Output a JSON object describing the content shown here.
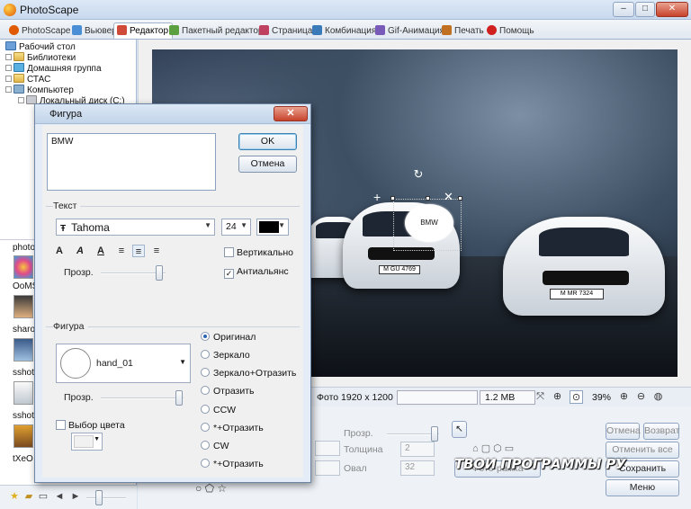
{
  "window": {
    "title": "PhotoScape",
    "min": "–",
    "max": "□",
    "close": "✕"
  },
  "tabs": [
    {
      "label": "PhotoScape",
      "color": "#e05a00"
    },
    {
      "label": "Вьювер",
      "color": "#4a8fd6"
    },
    {
      "label": "Редактор",
      "color": "#d04a3a"
    },
    {
      "label": "Пакетный редактор",
      "color": "#5aa040"
    },
    {
      "label": "Страница",
      "color": "#c04060"
    },
    {
      "label": "Комбинация",
      "color": "#3a7ab8"
    },
    {
      "label": "Gif-Анимация",
      "color": "#7a5ab8"
    },
    {
      "label": "Печать",
      "color": "#c07020"
    },
    {
      "label": "Помощь",
      "color": "#d02020"
    }
  ],
  "tree": [
    "Рабочий стол",
    "Библиотеки",
    "Домашняя группа",
    "СТАС",
    "Компьютер",
    "Локальный диск (C:)"
  ],
  "thumbs": [
    "photo",
    "OoMS",
    "sharo",
    "sshot",
    "sshot",
    "tXeO"
  ],
  "image": {
    "bubble_text": "BMW",
    "plate_left": "M GU 4769",
    "plate_right": "M MR 7324"
  },
  "status": {
    "photo_size": "Фото 1920 x 1200",
    "file_size": "1.2 MB",
    "zoom": "39%"
  },
  "editor": {
    "prozr_label": "Прозр.",
    "thickness_label": "Толщина",
    "thickness_value": "2",
    "oval_label": "Овал",
    "oval_value": "32",
    "photo_btn": "Фото-рамка",
    "cancel": "Отмена",
    "restore": "Возврат",
    "cancel_all": "Отменить все",
    "save": "Сохранить",
    "menu": "Меню",
    "watermark": "ТВОИ ПРОГРАММЫ РУ"
  },
  "dialog": {
    "title": "Фигура",
    "close": "✕",
    "text_value": "BMW",
    "ok": "OK",
    "cancel": "Отмена",
    "text_group": "Текст",
    "font": "Tahoma",
    "font_size": "24",
    "text_color": "#000000",
    "vertical": "Вертикально",
    "antialias": "Антиальянс",
    "prozr": "Прозр.",
    "shape_group": "Фигура",
    "shape_name": "hand_01",
    "shape_prozr": "Прозр.",
    "color_choice": "Выбор цвета",
    "radios": [
      {
        "label": "Оригинал",
        "checked": true
      },
      {
        "label": "Зеркало",
        "checked": false
      },
      {
        "label": "Зеркало+Отразить",
        "checked": false
      },
      {
        "label": "Отразить",
        "checked": false
      },
      {
        "label": "CCW",
        "checked": false
      },
      {
        "label": "*+Отразить",
        "checked": false
      },
      {
        "label": "CW",
        "checked": false
      },
      {
        "label": "*+Отразить",
        "checked": false
      }
    ]
  }
}
